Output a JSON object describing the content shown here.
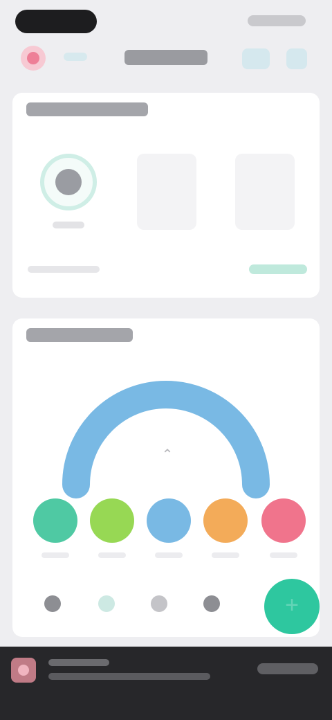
{
  "app": {
    "title": "",
    "colors": {
      "accent": "#2ec79f",
      "gauge": "#79b9e4",
      "mood_1": "#4fc9a3",
      "mood_2": "#97d854",
      "mood_3": "#79b9e4",
      "mood_4": "#f3ab59",
      "mood_5": "#f0748c"
    }
  },
  "nav": {
    "title": "",
    "left_icon": "profile-icon",
    "right_icons": [
      "calendar-icon",
      "settings-icon"
    ]
  },
  "card1": {
    "title": "",
    "tiles": [
      {
        "icon": "ring-icon",
        "label": ""
      },
      {
        "icon": "placeholder-icon",
        "label": ""
      },
      {
        "icon": "placeholder-icon",
        "label": ""
      }
    ],
    "footer_left": "",
    "footer_right": ""
  },
  "card2": {
    "title": "",
    "gauge_level": 1.0,
    "center_icon": "pointer-icon",
    "moods": [
      {
        "icon": "mood-very-good-icon",
        "label": ""
      },
      {
        "icon": "mood-good-icon",
        "label": ""
      },
      {
        "icon": "mood-neutral-icon",
        "label": ""
      },
      {
        "icon": "mood-bad-icon",
        "label": ""
      },
      {
        "icon": "mood-very-bad-icon",
        "label": ""
      }
    ]
  },
  "tabbar": {
    "tabs": [
      "home-icon",
      "stats-icon",
      "journal-icon",
      "profile-icon"
    ],
    "fab_icon": "add-icon"
  },
  "toast": {
    "icon": "notification-icon",
    "line1": "",
    "line2": "",
    "action": ""
  }
}
